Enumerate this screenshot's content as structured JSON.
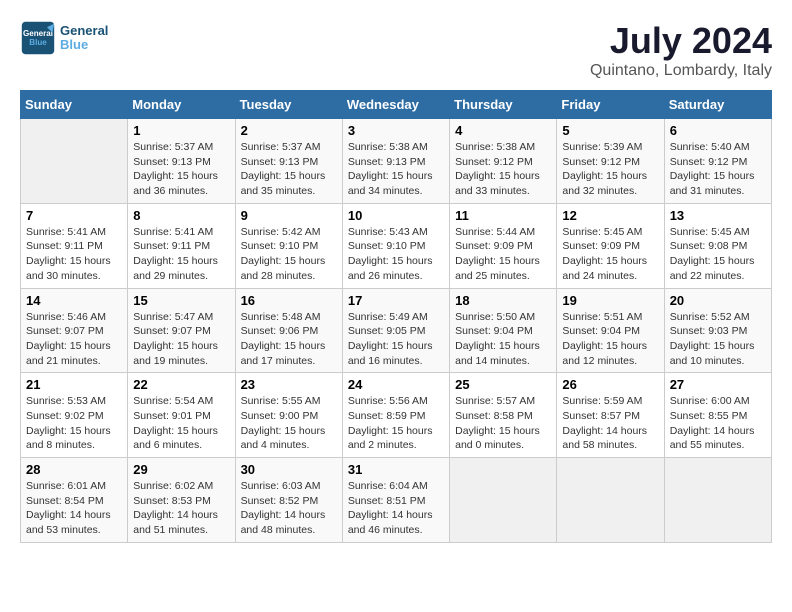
{
  "header": {
    "logo_general": "General",
    "logo_blue": "Blue",
    "month_year": "July 2024",
    "location": "Quintano, Lombardy, Italy"
  },
  "days_of_week": [
    "Sunday",
    "Monday",
    "Tuesday",
    "Wednesday",
    "Thursday",
    "Friday",
    "Saturday"
  ],
  "weeks": [
    [
      {
        "day": "",
        "detail": ""
      },
      {
        "day": "1",
        "detail": "Sunrise: 5:37 AM\nSunset: 9:13 PM\nDaylight: 15 hours\nand 36 minutes."
      },
      {
        "day": "2",
        "detail": "Sunrise: 5:37 AM\nSunset: 9:13 PM\nDaylight: 15 hours\nand 35 minutes."
      },
      {
        "day": "3",
        "detail": "Sunrise: 5:38 AM\nSunset: 9:13 PM\nDaylight: 15 hours\nand 34 minutes."
      },
      {
        "day": "4",
        "detail": "Sunrise: 5:38 AM\nSunset: 9:12 PM\nDaylight: 15 hours\nand 33 minutes."
      },
      {
        "day": "5",
        "detail": "Sunrise: 5:39 AM\nSunset: 9:12 PM\nDaylight: 15 hours\nand 32 minutes."
      },
      {
        "day": "6",
        "detail": "Sunrise: 5:40 AM\nSunset: 9:12 PM\nDaylight: 15 hours\nand 31 minutes."
      }
    ],
    [
      {
        "day": "7",
        "detail": "Sunrise: 5:41 AM\nSunset: 9:11 PM\nDaylight: 15 hours\nand 30 minutes."
      },
      {
        "day": "8",
        "detail": "Sunrise: 5:41 AM\nSunset: 9:11 PM\nDaylight: 15 hours\nand 29 minutes."
      },
      {
        "day": "9",
        "detail": "Sunrise: 5:42 AM\nSunset: 9:10 PM\nDaylight: 15 hours\nand 28 minutes."
      },
      {
        "day": "10",
        "detail": "Sunrise: 5:43 AM\nSunset: 9:10 PM\nDaylight: 15 hours\nand 26 minutes."
      },
      {
        "day": "11",
        "detail": "Sunrise: 5:44 AM\nSunset: 9:09 PM\nDaylight: 15 hours\nand 25 minutes."
      },
      {
        "day": "12",
        "detail": "Sunrise: 5:45 AM\nSunset: 9:09 PM\nDaylight: 15 hours\nand 24 minutes."
      },
      {
        "day": "13",
        "detail": "Sunrise: 5:45 AM\nSunset: 9:08 PM\nDaylight: 15 hours\nand 22 minutes."
      }
    ],
    [
      {
        "day": "14",
        "detail": "Sunrise: 5:46 AM\nSunset: 9:07 PM\nDaylight: 15 hours\nand 21 minutes."
      },
      {
        "day": "15",
        "detail": "Sunrise: 5:47 AM\nSunset: 9:07 PM\nDaylight: 15 hours\nand 19 minutes."
      },
      {
        "day": "16",
        "detail": "Sunrise: 5:48 AM\nSunset: 9:06 PM\nDaylight: 15 hours\nand 17 minutes."
      },
      {
        "day": "17",
        "detail": "Sunrise: 5:49 AM\nSunset: 9:05 PM\nDaylight: 15 hours\nand 16 minutes."
      },
      {
        "day": "18",
        "detail": "Sunrise: 5:50 AM\nSunset: 9:04 PM\nDaylight: 15 hours\nand 14 minutes."
      },
      {
        "day": "19",
        "detail": "Sunrise: 5:51 AM\nSunset: 9:04 PM\nDaylight: 15 hours\nand 12 minutes."
      },
      {
        "day": "20",
        "detail": "Sunrise: 5:52 AM\nSunset: 9:03 PM\nDaylight: 15 hours\nand 10 minutes."
      }
    ],
    [
      {
        "day": "21",
        "detail": "Sunrise: 5:53 AM\nSunset: 9:02 PM\nDaylight: 15 hours\nand 8 minutes."
      },
      {
        "day": "22",
        "detail": "Sunrise: 5:54 AM\nSunset: 9:01 PM\nDaylight: 15 hours\nand 6 minutes."
      },
      {
        "day": "23",
        "detail": "Sunrise: 5:55 AM\nSunset: 9:00 PM\nDaylight: 15 hours\nand 4 minutes."
      },
      {
        "day": "24",
        "detail": "Sunrise: 5:56 AM\nSunset: 8:59 PM\nDaylight: 15 hours\nand 2 minutes."
      },
      {
        "day": "25",
        "detail": "Sunrise: 5:57 AM\nSunset: 8:58 PM\nDaylight: 15 hours\nand 0 minutes."
      },
      {
        "day": "26",
        "detail": "Sunrise: 5:59 AM\nSunset: 8:57 PM\nDaylight: 14 hours\nand 58 minutes."
      },
      {
        "day": "27",
        "detail": "Sunrise: 6:00 AM\nSunset: 8:55 PM\nDaylight: 14 hours\nand 55 minutes."
      }
    ],
    [
      {
        "day": "28",
        "detail": "Sunrise: 6:01 AM\nSunset: 8:54 PM\nDaylight: 14 hours\nand 53 minutes."
      },
      {
        "day": "29",
        "detail": "Sunrise: 6:02 AM\nSunset: 8:53 PM\nDaylight: 14 hours\nand 51 minutes."
      },
      {
        "day": "30",
        "detail": "Sunrise: 6:03 AM\nSunset: 8:52 PM\nDaylight: 14 hours\nand 48 minutes."
      },
      {
        "day": "31",
        "detail": "Sunrise: 6:04 AM\nSunset: 8:51 PM\nDaylight: 14 hours\nand 46 minutes."
      },
      {
        "day": "",
        "detail": ""
      },
      {
        "day": "",
        "detail": ""
      },
      {
        "day": "",
        "detail": ""
      }
    ]
  ]
}
